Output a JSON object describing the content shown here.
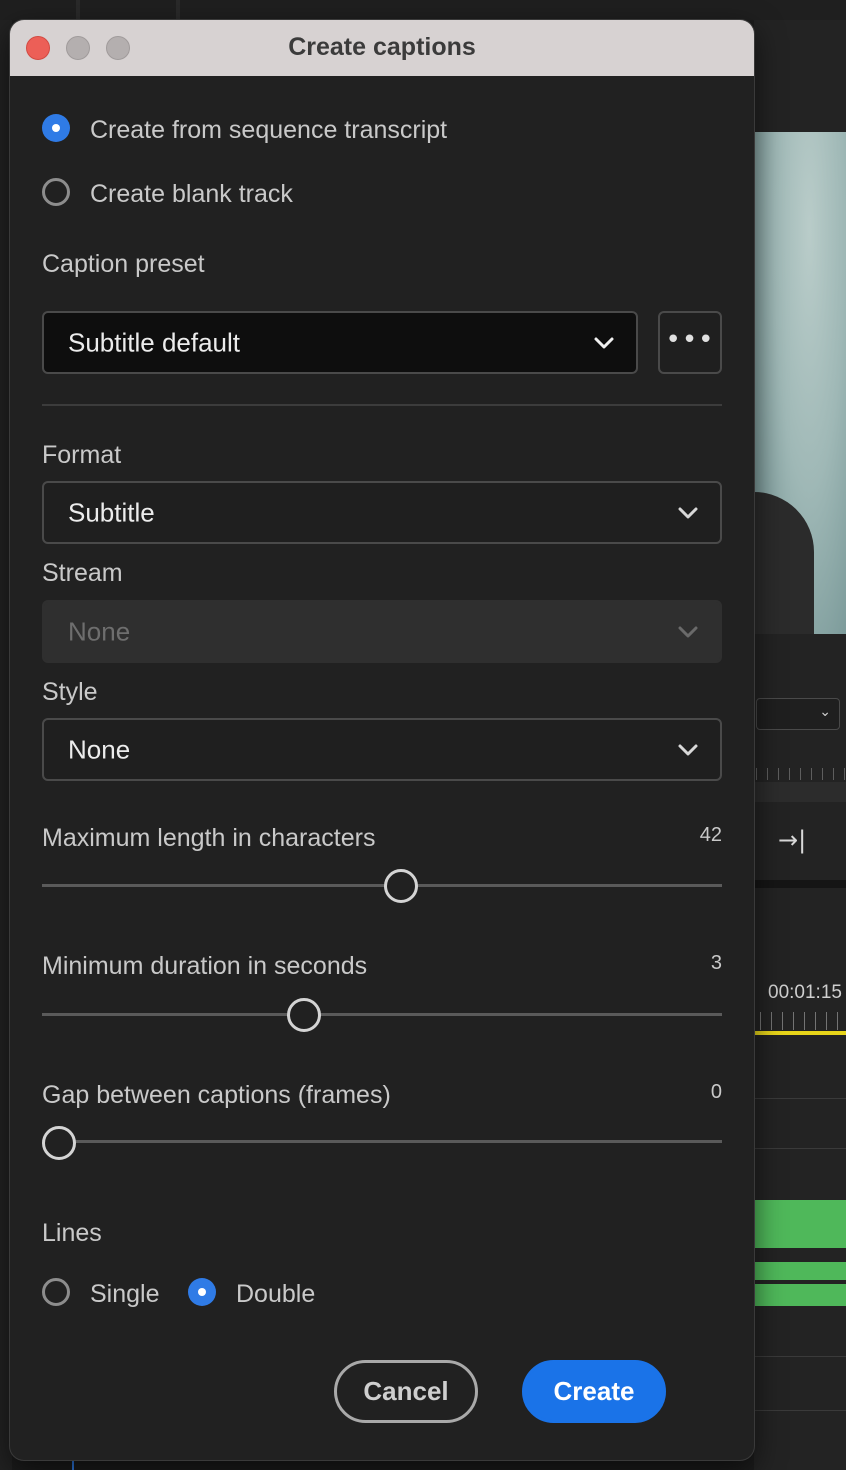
{
  "dialog": {
    "title": "Create captions",
    "source_options": [
      {
        "label": "Create from sequence transcript",
        "selected": true
      },
      {
        "label": "Create blank track",
        "selected": false
      }
    ],
    "caption_preset": {
      "label": "Caption preset",
      "value": "Subtitle default",
      "more_icon": "more-horizontal-icon"
    },
    "format": {
      "label": "Format",
      "value": "Subtitle"
    },
    "stream": {
      "label": "Stream",
      "value": "None",
      "disabled": true
    },
    "style": {
      "label": "Style",
      "value": "None"
    },
    "sliders": [
      {
        "label": "Maximum length in characters",
        "value": "42",
        "fraction": 0.53
      },
      {
        "label": "Minimum duration in seconds",
        "value": "3",
        "fraction": 0.38
      },
      {
        "label": "Gap between captions (frames)",
        "value": "0",
        "fraction": 0.0
      }
    ],
    "lines": {
      "label": "Lines",
      "options": [
        {
          "label": "Single",
          "selected": false
        },
        {
          "label": "Double",
          "selected": true
        }
      ]
    },
    "buttons": {
      "cancel": "Cancel",
      "create": "Create"
    }
  },
  "background": {
    "timecode": "00:01:15"
  },
  "colors": {
    "accent": "#1a73e8",
    "dialog_bg": "#212121",
    "titlebar": "#d7d2d2",
    "close": "#ec5f57",
    "timeline_clip": "#4fb85a",
    "playhead": "#e8d51a"
  }
}
